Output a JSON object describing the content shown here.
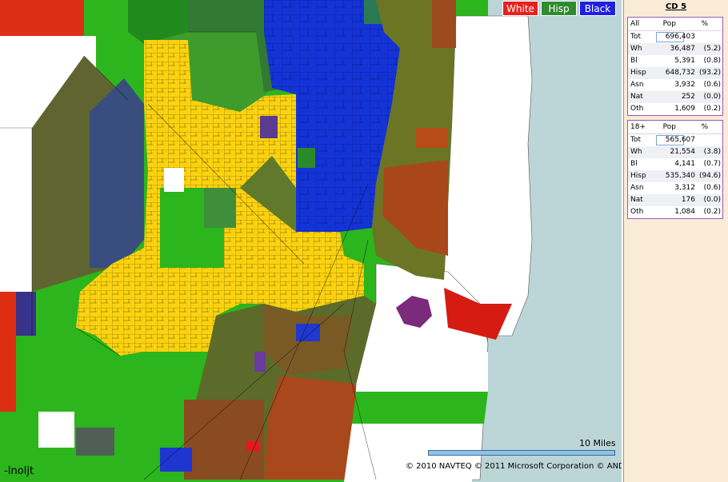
{
  "legend": [
    {
      "label": "White",
      "color": "#e8211d"
    },
    {
      "label": "Hisp",
      "color": "#2e8b2e"
    },
    {
      "label": "Black",
      "color": "#1f1fe0"
    }
  ],
  "map": {
    "scale_label": "10 Miles",
    "attribution": "© 2010 NAVTEQ   © 2011 Microsoft Corporation   © AND",
    "author": "-Inoljt"
  },
  "panel": {
    "title": "CD 5",
    "all": {
      "header": [
        "All",
        "Pop",
        "%"
      ],
      "rows": [
        {
          "label": "Tot",
          "pop": "696,403",
          "pct": ""
        },
        {
          "label": "Wh",
          "pop": "36,487",
          "pct": "(5.2)"
        },
        {
          "label": "Bl",
          "pop": "5,391",
          "pct": "(0.8)"
        },
        {
          "label": "Hisp",
          "pop": "648,732",
          "pct": "(93.2)"
        },
        {
          "label": "Asn",
          "pop": "3,932",
          "pct": "(0.6)"
        },
        {
          "label": "Nat",
          "pop": "252",
          "pct": "(0.0)"
        },
        {
          "label": "Oth",
          "pop": "1,609",
          "pct": "(0.2)"
        }
      ]
    },
    "adult": {
      "header": [
        "18+",
        "Pop",
        "%"
      ],
      "rows": [
        {
          "label": "Tot",
          "pop": "565,607",
          "pct": ""
        },
        {
          "label": "Wh",
          "pop": "21,554",
          "pct": "(3.8)"
        },
        {
          "label": "Bl",
          "pop": "4,141",
          "pct": "(0.7)"
        },
        {
          "label": "Hisp",
          "pop": "535,340",
          "pct": "(94.6)"
        },
        {
          "label": "Asn",
          "pop": "3,312",
          "pct": "(0.6)"
        },
        {
          "label": "Nat",
          "pop": "176",
          "pct": "(0.0)"
        },
        {
          "label": "Oth",
          "pop": "1,084",
          "pct": "(0.2)"
        }
      ]
    }
  }
}
